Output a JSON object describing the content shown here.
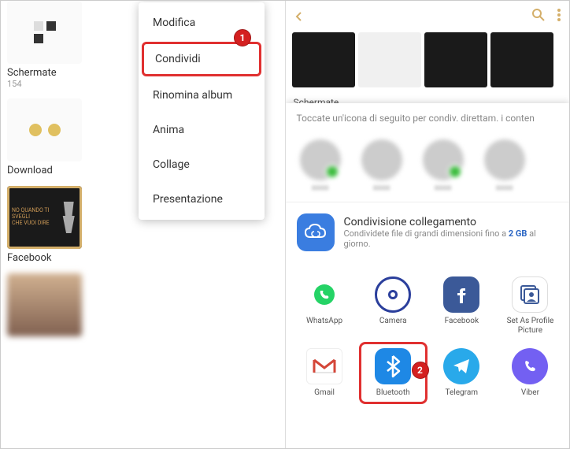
{
  "left_pane": {
    "albums": [
      {
        "name": "Schermate",
        "count": "154"
      },
      {
        "name": "Download",
        "count": ""
      },
      {
        "name": "Facebook",
        "count": ""
      }
    ],
    "menu": {
      "items": [
        "Modifica",
        "Condividi",
        "Rinomina album",
        "Anima",
        "Collage",
        "Presentazione"
      ],
      "highlighted_index": 1
    },
    "badge": "1"
  },
  "right_pane": {
    "strip_caption": "Schermate",
    "share_hint": "Toccate un'icona di seguito per condiv. direttam. i conten",
    "link_share": {
      "title": "Condivisione collegamento",
      "desc_prefix": "Condividete file di grandi dimensioni fino a ",
      "desc_bold": "2 GB",
      "desc_suffix": " al giorno."
    },
    "apps": [
      {
        "label": "WhatsApp",
        "icon": "whatsapp"
      },
      {
        "label": "Camera",
        "icon": "camera"
      },
      {
        "label": "Facebook",
        "icon": "facebook"
      },
      {
        "label": "Set As Profile Picture",
        "icon": "profile"
      },
      {
        "label": "Gmail",
        "icon": "gmail"
      },
      {
        "label": "Bluetooth",
        "icon": "bluetooth"
      },
      {
        "label": "Telegram",
        "icon": "telegram"
      },
      {
        "label": "Viber",
        "icon": "viber"
      }
    ],
    "highlighted_app_index": 5,
    "badge": "2"
  }
}
